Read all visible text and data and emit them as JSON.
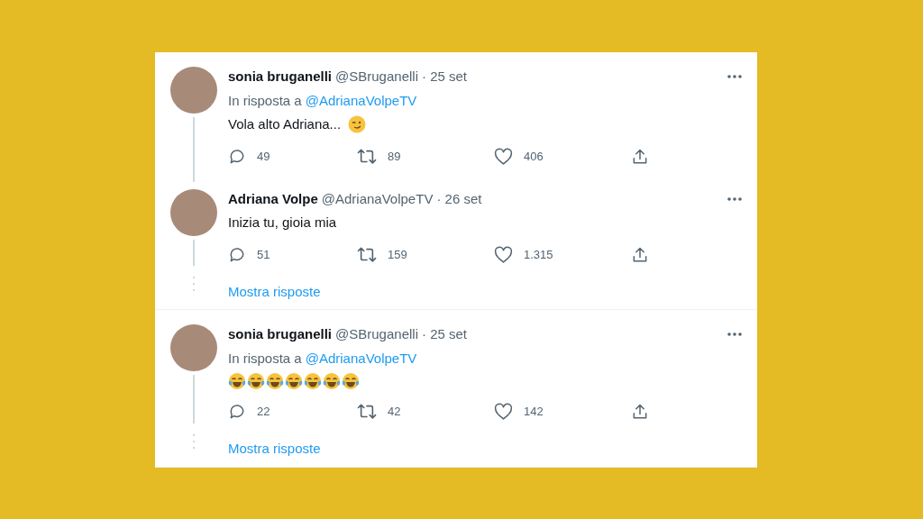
{
  "tweets": [
    {
      "author": "sonia bruganelli",
      "handle": "@SBruganelli",
      "date": "· 25 set",
      "reply_to": {
        "prefix": "In risposta a",
        "handle": "@AdrianaVolpeTV"
      },
      "text": "Vola alto Adriana...",
      "emoji": [
        {
          "kind": "wink"
        }
      ],
      "stats": {
        "replies": "49",
        "retweets": "89",
        "likes": "406"
      },
      "thread": {
        "kind": "continues"
      }
    },
    {
      "author": "Adriana Volpe",
      "handle": "@AdrianaVolpeTV",
      "date": "· 26 set",
      "text": "Inizia tu, gioia mia",
      "stats": {
        "replies": "51",
        "retweets": "159",
        "likes": "1.315"
      },
      "thread": {
        "kind": "more"
      },
      "show_replies": "Mostra risposte"
    },
    {
      "author": "sonia bruganelli",
      "handle": "@SBruganelli",
      "date": "· 25 set",
      "reply_to": {
        "prefix": "In risposta a",
        "handle": "@AdrianaVolpeTV"
      },
      "emoji": [
        {
          "kind": "tears_of_joy"
        },
        {
          "kind": "tears_of_joy"
        },
        {
          "kind": "tears_of_joy"
        },
        {
          "kind": "tears_of_joy"
        },
        {
          "kind": "tears_of_joy"
        },
        {
          "kind": "tears_of_joy"
        },
        {
          "kind": "tears_of_joy"
        }
      ],
      "stats": {
        "replies": "22",
        "retweets": "42",
        "likes": "142"
      },
      "thread": {
        "kind": "more"
      },
      "show_replies": "Mostra risposte"
    }
  ]
}
